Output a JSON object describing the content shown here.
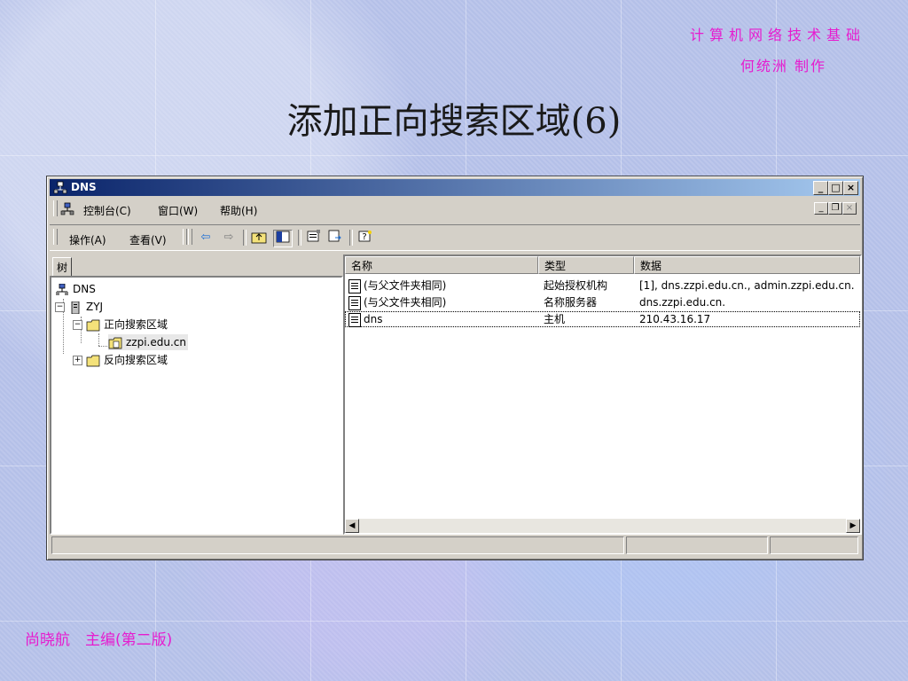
{
  "slide": {
    "course": "计算机网络技术基础",
    "author": "何统洲 制作",
    "title": "添加正向搜索区域(6)",
    "footer": "尚晓航　主编(第二版)"
  },
  "window": {
    "title": "DNS",
    "menu": [
      "控制台(C)",
      "窗口(W)",
      "帮助(H)"
    ],
    "toolbar_menu": [
      "操作(A)",
      "查看(V)"
    ],
    "title_buttons": [
      "_",
      "□",
      "×"
    ],
    "mdi_buttons": [
      "_",
      "❐",
      "×"
    ]
  },
  "tree": {
    "tab_label": "树",
    "items": [
      {
        "label": "DNS"
      },
      {
        "label": "ZYJ"
      },
      {
        "label": "正向搜索区域"
      },
      {
        "label": "zzpi.edu.cn"
      },
      {
        "label": "反向搜索区域"
      }
    ]
  },
  "list": {
    "columns": [
      "名称",
      "类型",
      "数据"
    ],
    "rows": [
      {
        "name": "(与父文件夹相同)",
        "type": "起始授权机构",
        "data": "[1], dns.zzpi.edu.cn., admin.zzpi.edu.cn."
      },
      {
        "name": "(与父文件夹相同)",
        "type": "名称服务器",
        "data": "dns.zzpi.edu.cn."
      },
      {
        "name": "dns",
        "type": "主机",
        "data": "210.43.16.17"
      }
    ]
  }
}
